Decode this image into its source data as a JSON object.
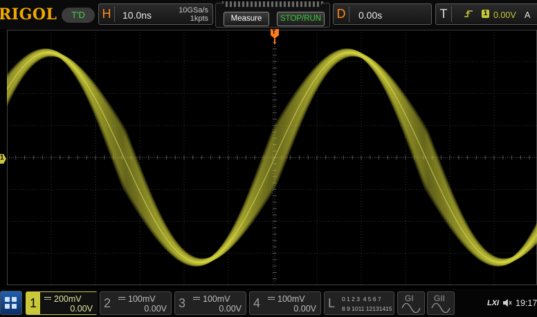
{
  "brand": "RIGOL",
  "trigger_state": "T'D",
  "colors": {
    "brand": "#f0a800",
    "channel1": "#c8c83a",
    "trigger": "#ff7a1a",
    "accent_green": "#35d035",
    "dim": "#8a8a8a"
  },
  "horizontal": {
    "letter": "H",
    "timebase": "10.0ns",
    "sample_rate": "10GSa/s",
    "memory_depth": "1kpts"
  },
  "toolbar": {
    "measure_label": "Measure",
    "stop_run_label": "STOP/RUN"
  },
  "delay": {
    "letter": "D",
    "value": "0.00s"
  },
  "trigger": {
    "letter": "T",
    "icon": "rising-edge-icon",
    "source": "1",
    "level": "0.00V",
    "mode": "A"
  },
  "markers": {
    "ch1": "1",
    "trigger_top": "T"
  },
  "channels": [
    {
      "num": "1",
      "scale": "200mV",
      "offset": "0.00V",
      "active": true
    },
    {
      "num": "2",
      "scale": "100mV",
      "offset": "0.00V",
      "active": false
    },
    {
      "num": "3",
      "scale": "100mV",
      "offset": "0.00V",
      "active": false
    },
    {
      "num": "4",
      "scale": "100mV",
      "offset": "0.00V",
      "active": false
    }
  ],
  "logic": {
    "letter": "L",
    "row1": "0 1 2 3  4 5 6 7",
    "row2": "8 9 1011 12131415"
  },
  "generators": [
    {
      "label": "GI",
      "icon": "sine-wave-icon"
    },
    {
      "label": "GII",
      "icon": "sine-wave-icon"
    }
  ],
  "status": {
    "lxi": "LXI",
    "speaker_icon": "speaker-icon",
    "time": "19:17"
  }
}
